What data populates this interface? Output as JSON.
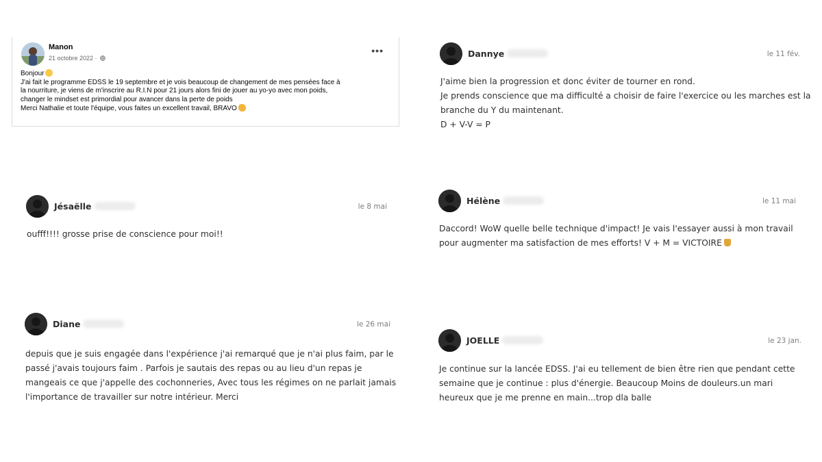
{
  "facebook_post": {
    "author": "Manon",
    "date": "21 octobre 2022 ·",
    "more_label": "•••",
    "lines": [
      "Bonjour",
      "J'ai fait le programme EDSS le 19 septembre et je vois beaucoup de changement de mes pensées face à",
      "la nourriture, je viens de m'inscrire au R.I.N pour 21 jours alors fini de jouer au yo-yo avec mon poids,",
      "changer le mindset est primordial pour avancer dans la perte de poids",
      "Merci Nathalie et toute l'équipe, vous faites un excellent travail, BRAVO"
    ]
  },
  "reviews": [
    {
      "name": "Dannye",
      "date": "le 11 fév.",
      "lines": [
        "J'aime bien la progression et donc éviter de tourner en rond.",
        "Je prends conscience que ma difficulté a choisir de faire l'exercice ou les marches est la",
        "branche du Y du maintenant.",
        "D + V-V = P"
      ]
    },
    {
      "name": "Jésaëlle",
      "date": "le 8 mai",
      "lines": [
        "oufff!!!! grosse prise de conscience pour moi!!"
      ]
    },
    {
      "name": "Hélène",
      "date": "le 11 mai",
      "lines": [
        "Daccord! WoW quelle belle technique d'impact! Je vais l'essayer aussi à mon travail",
        "pour augmenter ma satisfaction de mes efforts! V + M = VICTOIRE"
      ]
    },
    {
      "name": "Diane",
      "date": "le 26 mai",
      "lines": [
        "depuis que je suis engagée dans l'expérience j'ai remarqué que je n'ai plus faim, par le",
        "passé j'avais toujours faim . Parfois je sautais des repas ou au lieu d'un repas je",
        "mangeais ce que j'appelle des cochonneries, Avec tous les régimes on ne parlait jamais",
        "l'importance de travailler sur notre intérieur. Merci"
      ]
    },
    {
      "name": "JOELLE",
      "date": "le 23 jan.",
      "lines": [
        "Je continue sur la lancée EDSS. J'ai eu tellement de bien être rien que pendant cette",
        "semaine que je continue : plus d'énergie. Beaucoup Moins de douleurs.un mari",
        "heureux que je me prenne en main...trop dla balle"
      ]
    }
  ],
  "colors": {
    "avatar_dark": "#2b2b2b",
    "date_gray": "#7d7d7d",
    "body_text": "#2f2f2f"
  }
}
